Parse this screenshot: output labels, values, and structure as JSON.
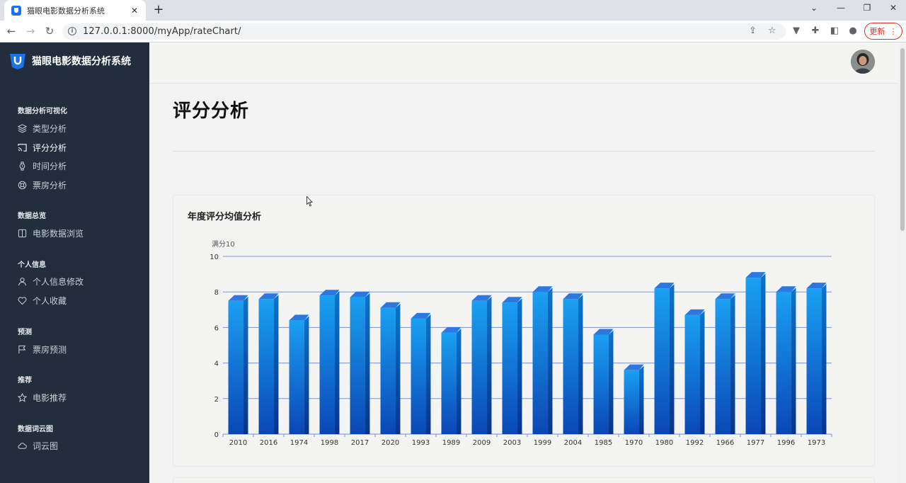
{
  "browser": {
    "tab_title": "猫眼电影数据分析系统",
    "url": "127.0.0.1:8000/myApp/rateChart/",
    "update_label": "更新"
  },
  "sidebar": {
    "brand": "猫眼电影数据分析系统",
    "sections": [
      {
        "header": "数据分析可视化",
        "items": [
          {
            "label": "类型分析",
            "icon": "layers-icon"
          },
          {
            "label": "评分分析",
            "icon": "cast-icon",
            "active": true
          },
          {
            "label": "时间分析",
            "icon": "watch-icon"
          },
          {
            "label": "票房分析",
            "icon": "life-buoy-icon"
          }
        ]
      },
      {
        "header": "数据总览",
        "items": [
          {
            "label": "电影数据浏览",
            "icon": "columns-icon"
          }
        ]
      },
      {
        "header": "个人信息",
        "items": [
          {
            "label": "个人信息修改",
            "icon": "user-icon"
          },
          {
            "label": "个人收藏",
            "icon": "heart-icon"
          }
        ]
      },
      {
        "header": "预测",
        "items": [
          {
            "label": "票房预测",
            "icon": "flag-icon"
          }
        ]
      },
      {
        "header": "推荐",
        "items": [
          {
            "label": "电影推荐",
            "icon": "star-icon"
          }
        ]
      },
      {
        "header": "数据词云图",
        "items": [
          {
            "label": "词云图",
            "icon": "cloud-icon"
          }
        ]
      }
    ]
  },
  "page": {
    "title": "评分分析",
    "card_title": "年度评分均值分析"
  },
  "chart_data": {
    "type": "bar",
    "title": "年度评分均值分析",
    "ylabel": "满分10",
    "xlabel": "",
    "ylim": [
      0,
      10
    ],
    "yticks": [
      0,
      2,
      4,
      6,
      8,
      10
    ],
    "grid": true,
    "categories": [
      "2010",
      "2016",
      "1974",
      "1998",
      "2017",
      "2020",
      "1993",
      "1989",
      "2009",
      "2003",
      "1999",
      "2004",
      "1985",
      "1970",
      "1980",
      "1992",
      "1966",
      "1977",
      "1996",
      "1973"
    ],
    "values": [
      7.5,
      7.6,
      6.4,
      7.8,
      7.7,
      7.1,
      6.5,
      5.7,
      7.5,
      7.4,
      8.0,
      7.6,
      5.6,
      3.6,
      8.2,
      6.7,
      7.6,
      8.8,
      8.0,
      8.2
    ],
    "colors": {
      "bar_top": "#1aa0f2",
      "bar_bottom": "#0b47b5",
      "bar_cap": "#2a78e0",
      "grid": "#7f93c9",
      "axis": "#6f8fd3"
    }
  }
}
